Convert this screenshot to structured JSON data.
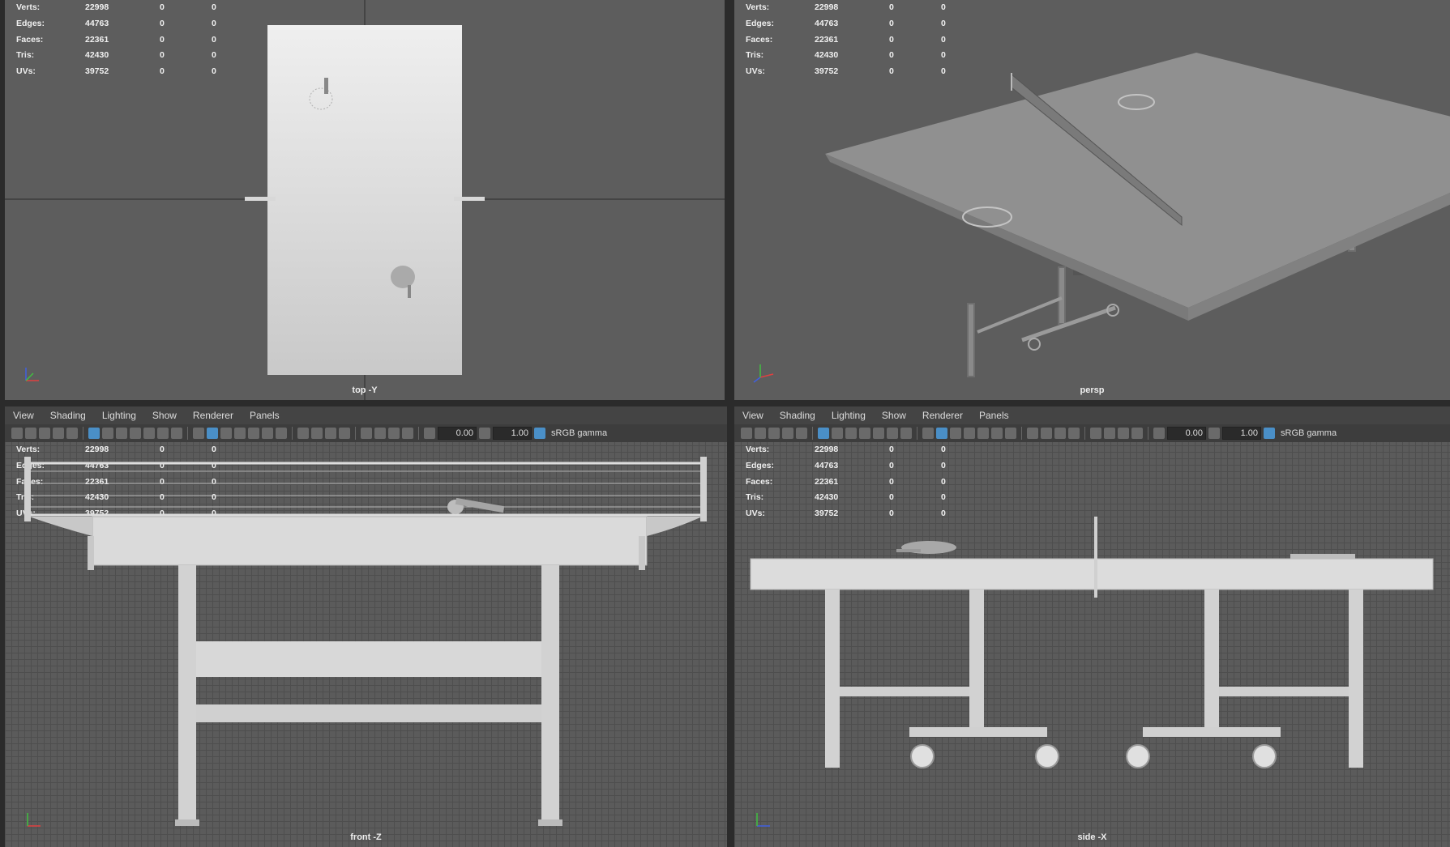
{
  "stats": {
    "rows": [
      {
        "label": "Verts:",
        "v1": "22998",
        "v2": "0",
        "v3": "0"
      },
      {
        "label": "Edges:",
        "v1": "44763",
        "v2": "0",
        "v3": "0"
      },
      {
        "label": "Faces:",
        "v1": "22361",
        "v2": "0",
        "v3": "0"
      },
      {
        "label": "Tris:",
        "v1": "42430",
        "v2": "0",
        "v3": "0"
      },
      {
        "label": "UVs:",
        "v1": "39752",
        "v2": "0",
        "v3": "0"
      }
    ]
  },
  "menu": [
    "View",
    "Shading",
    "Lighting",
    "Show",
    "Renderer",
    "Panels"
  ],
  "toolbar": {
    "exposure": "0.00",
    "gamma": "1.00",
    "colorspace": "sRGB gamma"
  },
  "viewports": {
    "top": "top -Y",
    "persp": "persp",
    "front": "front -Z",
    "side": "side -X"
  },
  "axis": {
    "x": "x",
    "y": "y",
    "z": "z"
  },
  "colors": {
    "viewport_bg": "#5d5d5d",
    "active_icon": "#4a8fc7",
    "axis_x": "#e04040",
    "axis_y": "#40c040",
    "axis_z": "#4060e0"
  }
}
